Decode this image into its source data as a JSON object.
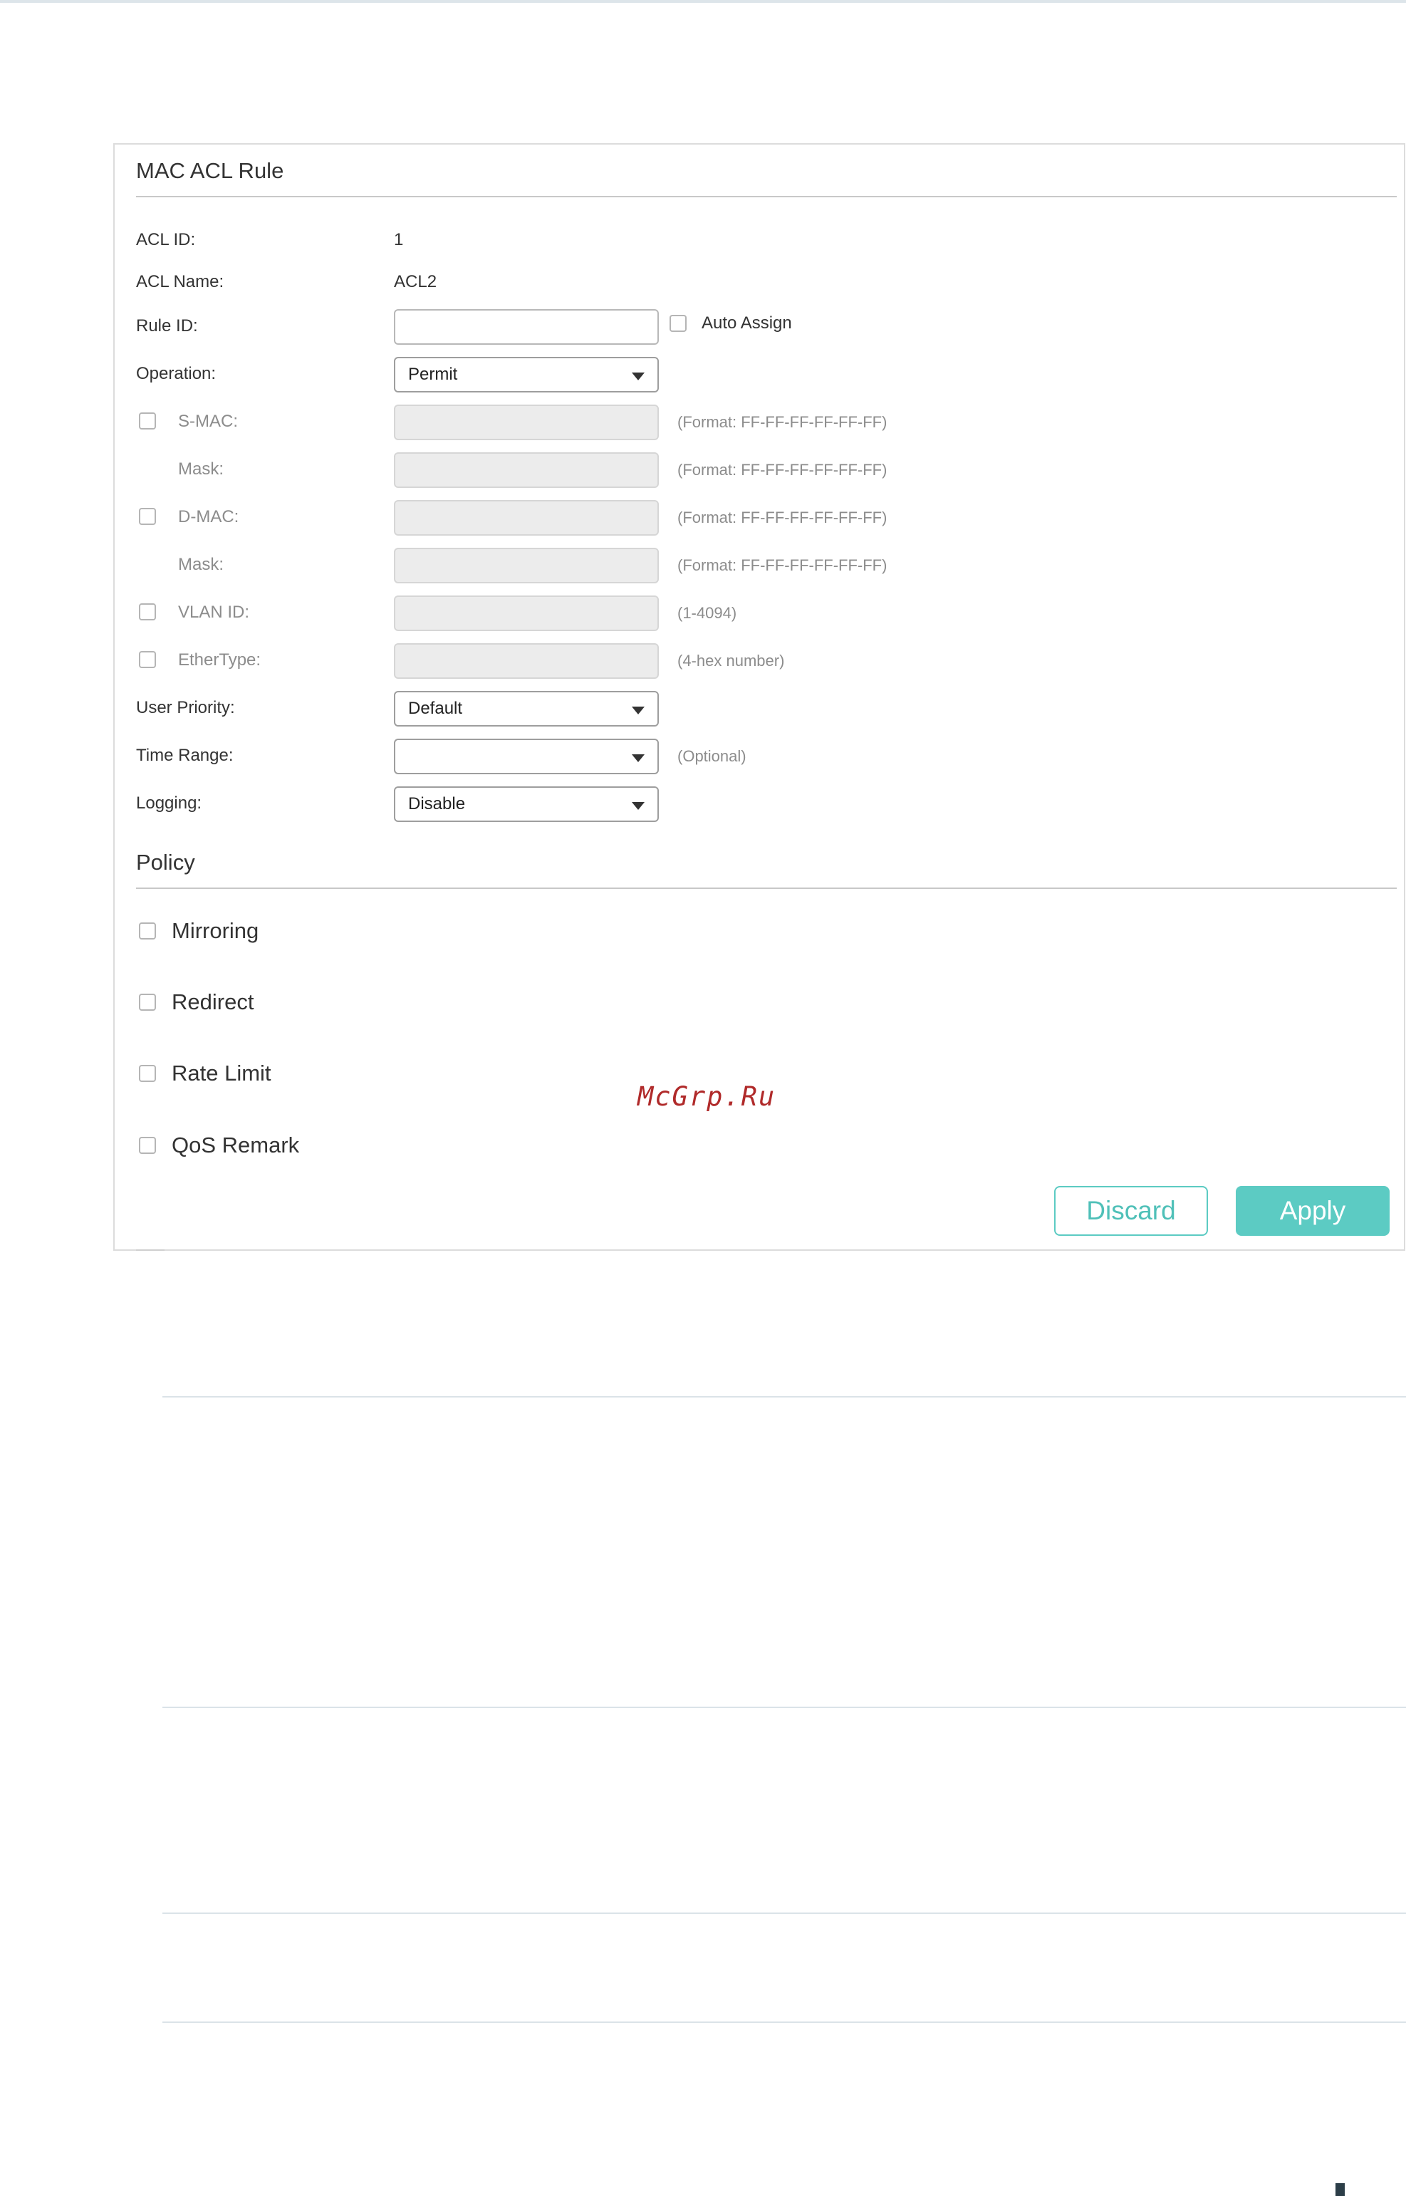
{
  "panel": {
    "title": "MAC ACL Rule",
    "fields": {
      "acl_id_label": "ACL ID:",
      "acl_id_value": "1",
      "acl_name_label": "ACL Name:",
      "acl_name_value": "ACL2",
      "rule_id_label": "Rule ID:",
      "rule_id_value": "",
      "auto_assign_label": "Auto Assign",
      "operation_label": "Operation:",
      "operation_value": "Permit",
      "smac_label": "S-MAC:",
      "smac_hint": "(Format: FF-FF-FF-FF-FF-FF)",
      "smac_mask_label": "Mask:",
      "smac_mask_hint": "(Format: FF-FF-FF-FF-FF-FF)",
      "dmac_label": "D-MAC:",
      "dmac_hint": "(Format: FF-FF-FF-FF-FF-FF)",
      "dmac_mask_label": "Mask:",
      "dmac_mask_hint": "(Format: FF-FF-FF-FF-FF-FF)",
      "vlan_label": "VLAN ID:",
      "vlan_hint": "(1-4094)",
      "ethertype_label": "EtherType:",
      "ethertype_hint": "(4-hex number)",
      "user_priority_label": "User Priority:",
      "user_priority_value": "Default",
      "time_range_label": "Time Range:",
      "time_range_value": "",
      "time_range_hint": "(Optional)",
      "logging_label": "Logging:",
      "logging_value": "Disable"
    },
    "policy": {
      "title": "Policy",
      "items": [
        "Mirroring",
        "Redirect",
        "Rate Limit",
        "QoS Remark"
      ]
    },
    "buttons": {
      "discard": "Discard",
      "apply": "Apply"
    }
  },
  "watermark": "McGrp.Ru",
  "colors": {
    "accent": "#5ccbc3",
    "watermark": "#b02a2a",
    "disabled_input": "#ececec"
  }
}
